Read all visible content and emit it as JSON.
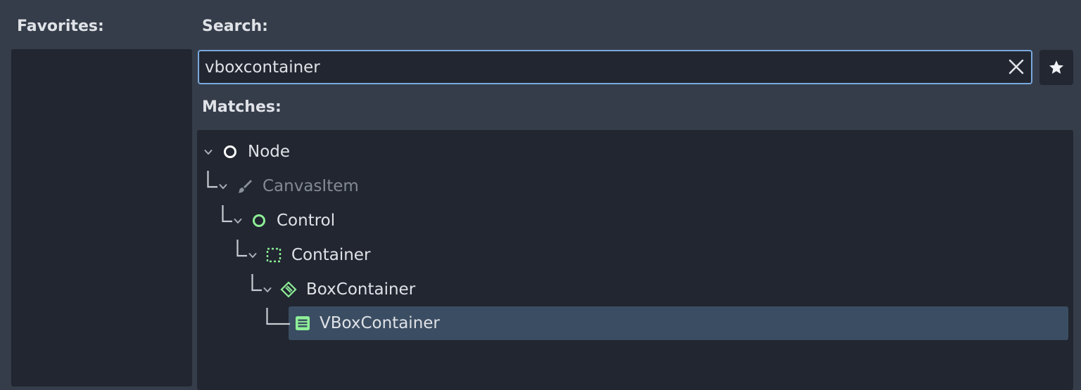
{
  "labels": {
    "favorites": "Favorites:",
    "search": "Search:",
    "matches": "Matches:"
  },
  "search": {
    "value": "vboxcontainer"
  },
  "icons": {
    "clear": "close-icon",
    "favorite": "star-icon"
  },
  "tree": {
    "items": [
      {
        "label": "Node",
        "icon": "node-circle-icon",
        "dimmed": false,
        "selected": false
      },
      {
        "label": "CanvasItem",
        "icon": "brush-icon",
        "dimmed": true,
        "selected": false
      },
      {
        "label": "Control",
        "icon": "control-circle-icon",
        "dimmed": false,
        "selected": false
      },
      {
        "label": "Container",
        "icon": "container-dotted-icon",
        "dimmed": false,
        "selected": false
      },
      {
        "label": "BoxContainer",
        "icon": "boxcontainer-icon",
        "dimmed": false,
        "selected": false
      },
      {
        "label": "VBoxContainer",
        "icon": "vboxcontainer-icon",
        "dimmed": false,
        "selected": true
      }
    ]
  },
  "colors": {
    "background": "#363d4a",
    "panel": "#212630",
    "accent": "#79a9df",
    "selection": "#3b4d62",
    "control_green": "#8eef97"
  }
}
